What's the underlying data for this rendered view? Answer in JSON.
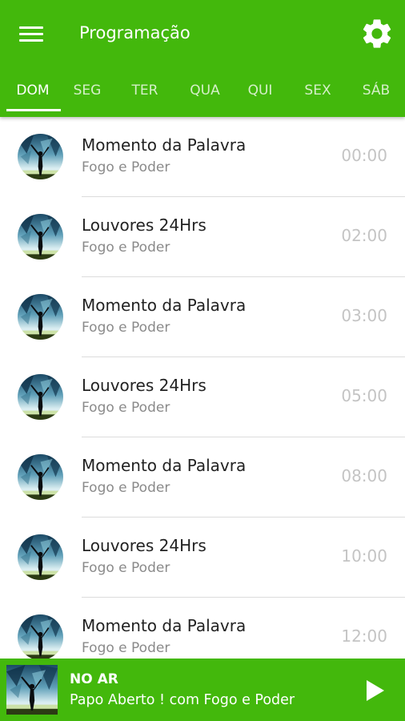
{
  "app": {
    "title": "Programação",
    "accent_color": "#43b80c"
  },
  "header": {
    "menu_icon": "hamburger-menu-icon",
    "settings_icon": "gear-icon"
  },
  "tabs": [
    {
      "label": "DOM",
      "active": true
    },
    {
      "label": "SEG",
      "active": false
    },
    {
      "label": "TER",
      "active": false
    },
    {
      "label": "QUA",
      "active": false
    },
    {
      "label": "QUI",
      "active": false
    },
    {
      "label": "SEX",
      "active": false
    },
    {
      "label": "SÁB",
      "active": false
    }
  ],
  "schedule": [
    {
      "title": "Momento da Palavra",
      "subtitle": "Fogo e Poder",
      "time": "00:00"
    },
    {
      "title": "Louvores 24Hrs",
      "subtitle": "Fogo e Poder",
      "time": "02:00"
    },
    {
      "title": "Momento da Palavra",
      "subtitle": "Fogo e Poder",
      "time": "03:00"
    },
    {
      "title": "Louvores 24Hrs",
      "subtitle": "Fogo e Poder",
      "time": "05:00"
    },
    {
      "title": "Momento da Palavra",
      "subtitle": "Fogo e Poder",
      "time": "08:00"
    },
    {
      "title": "Louvores 24Hrs",
      "subtitle": "Fogo e Poder",
      "time": "10:00"
    },
    {
      "title": "Momento da Palavra",
      "subtitle": "Fogo e Poder",
      "time": "12:00"
    }
  ],
  "player": {
    "status_label": "NO AR",
    "now_playing": "Papo Aberto ! com Fogo e Poder",
    "play_icon": "play-icon"
  }
}
